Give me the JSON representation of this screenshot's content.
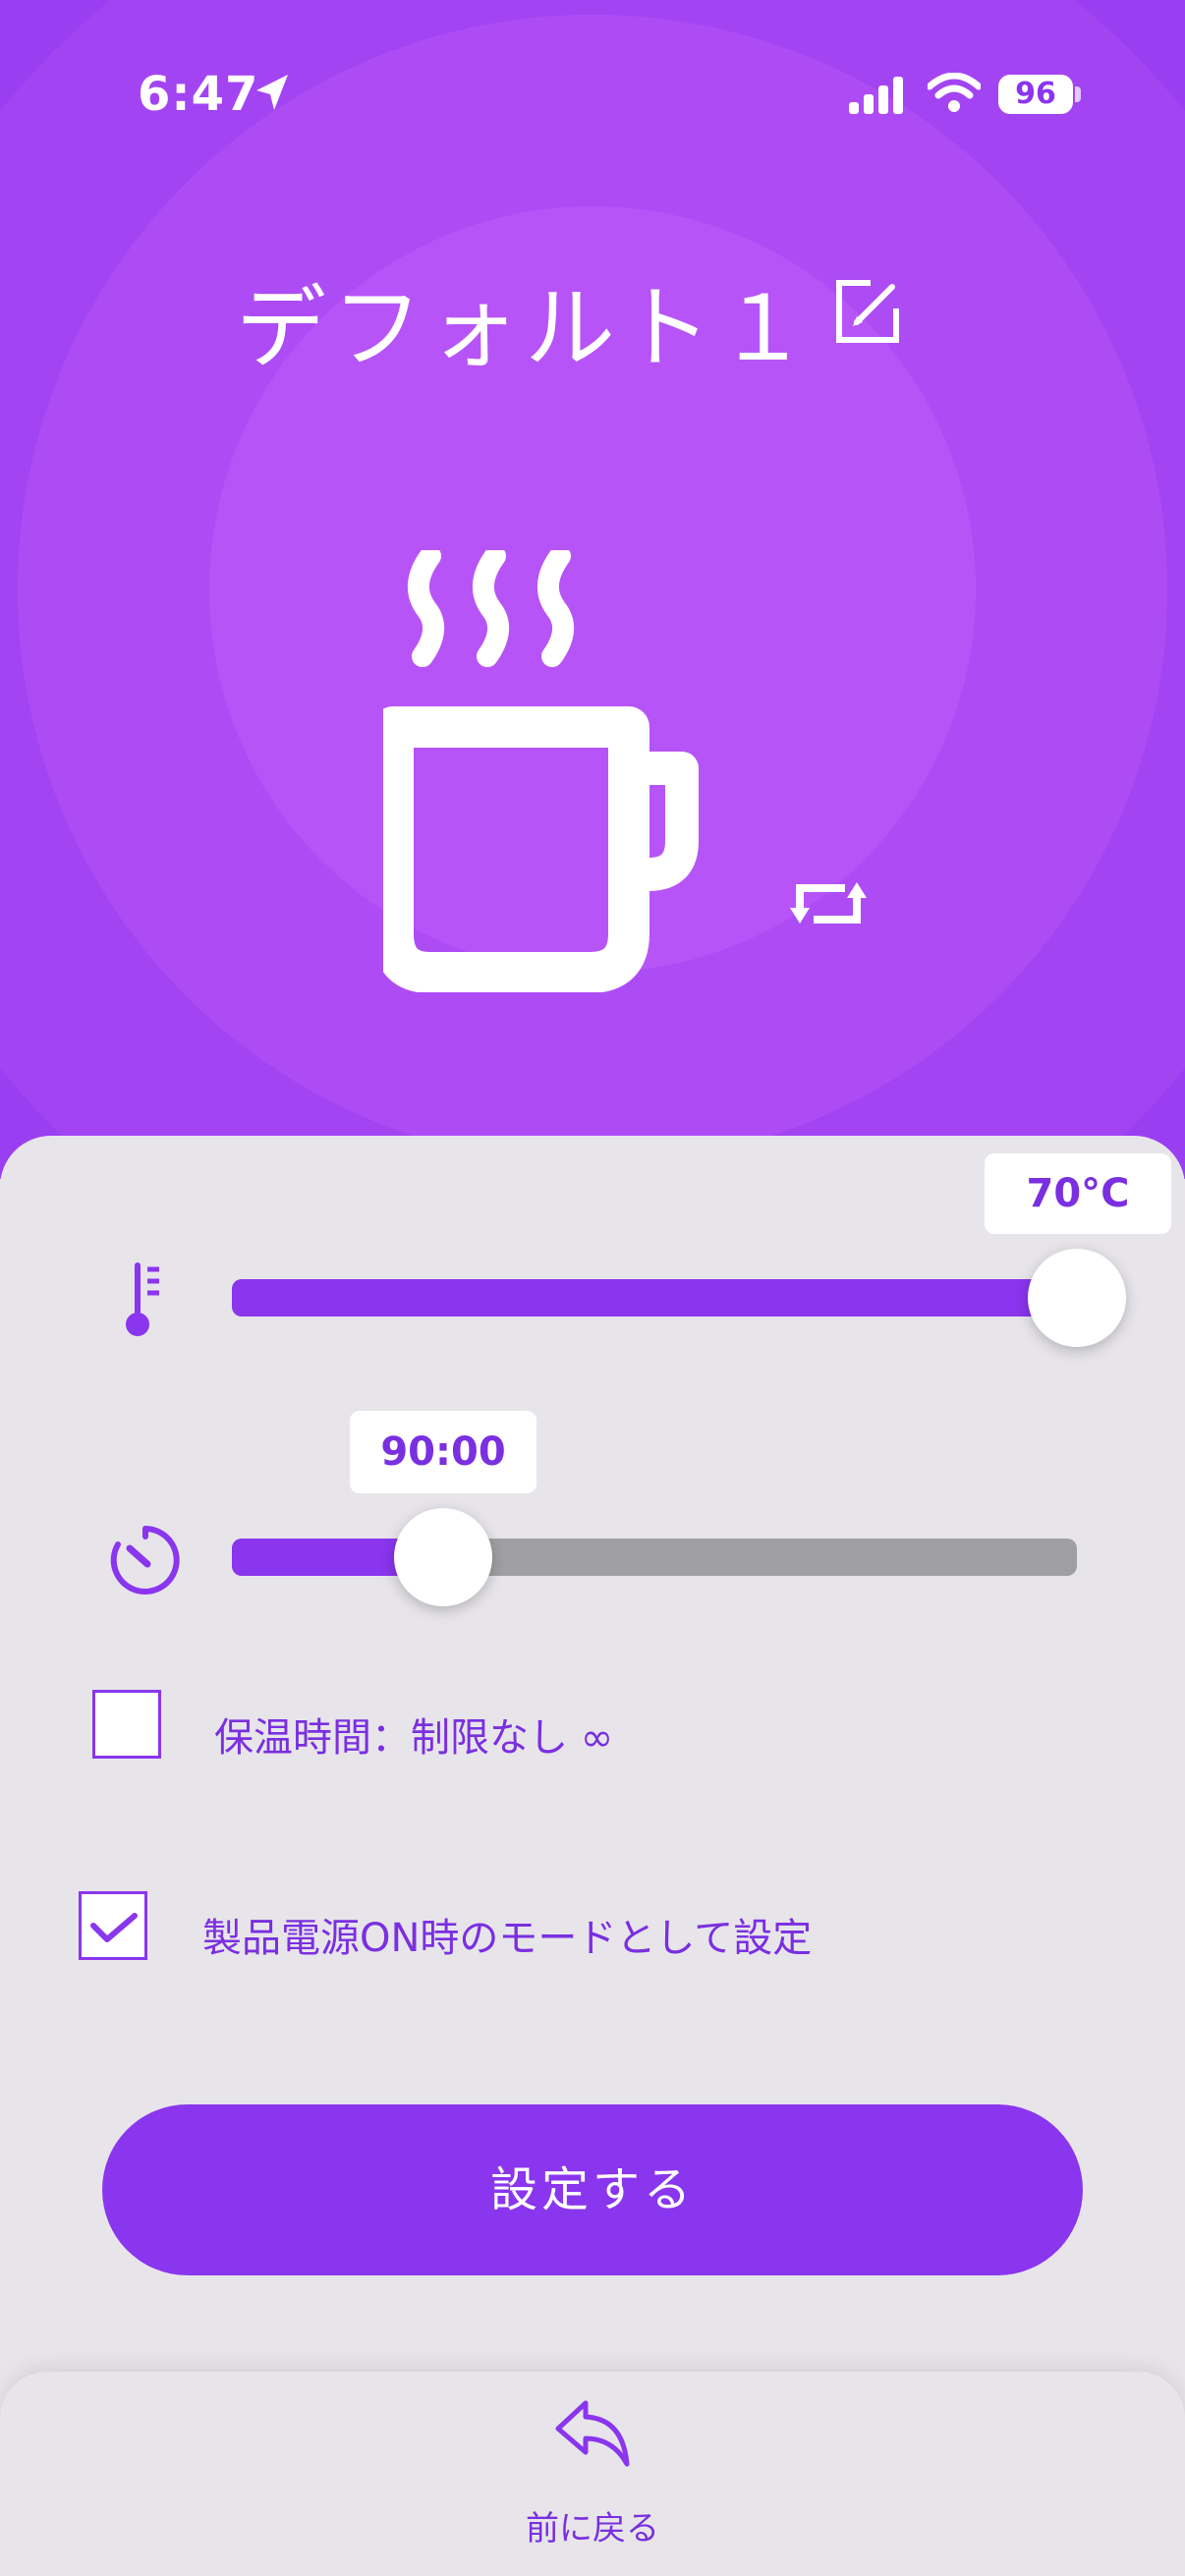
{
  "status_bar": {
    "time": "6:47",
    "battery": "96"
  },
  "mode": {
    "title": "デフォルト１"
  },
  "temperature": {
    "value_label": "70°C",
    "level": 1.0
  },
  "timer": {
    "value_label": "90:00",
    "level": 0.25
  },
  "options": {
    "unlimited_label": "保温時間：制限なし ∞",
    "unlimited_checked": false,
    "poweron_label": "製品電源ON時のモードとして設定",
    "poweron_checked": true
  },
  "actions": {
    "set_label": "設定する"
  },
  "footer": {
    "back_label": "前に戻る"
  },
  "colors": {
    "accent": "#8a35ee",
    "track_inactive": "#a0a0a2",
    "panel_bg": "#e7e5ea"
  }
}
